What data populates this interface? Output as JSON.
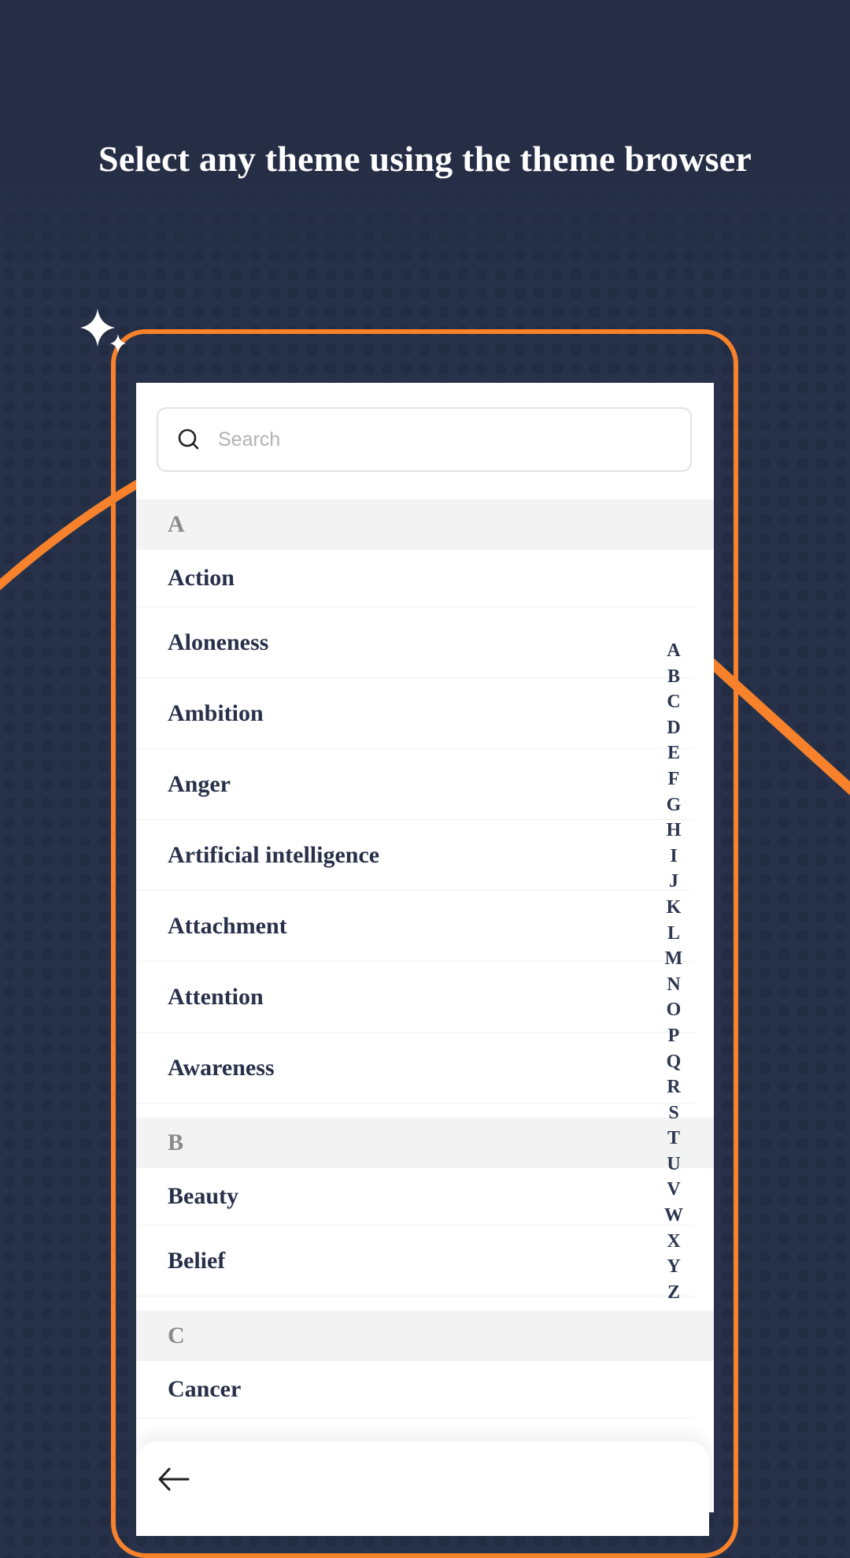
{
  "headline": "Select any theme using the theme browser",
  "colors": {
    "background": "#27324a",
    "accent": "#f7822b",
    "text_dark": "#28304a",
    "section_text": "#8a8a8a"
  },
  "search": {
    "placeholder": "Search",
    "value": "",
    "icon": "search-icon"
  },
  "sections": [
    {
      "letter": "A",
      "items": [
        "Action",
        "Aloneness",
        "Ambition",
        "Anger",
        "Artificial intelligence",
        "Attachment",
        "Attention",
        "Awareness"
      ]
    },
    {
      "letter": "B",
      "items": [
        "Beauty",
        "Belief"
      ]
    },
    {
      "letter": "C",
      "items": [
        "Cancer"
      ]
    }
  ],
  "alphabet_index": [
    "A",
    "B",
    "C",
    "D",
    "E",
    "F",
    "G",
    "H",
    "I",
    "J",
    "K",
    "L",
    "M",
    "N",
    "O",
    "P",
    "Q",
    "R",
    "S",
    "T",
    "U",
    "V",
    "W",
    "X",
    "Y",
    "Z"
  ],
  "bottom_bar": {
    "back_icon": "arrow-left-icon"
  }
}
